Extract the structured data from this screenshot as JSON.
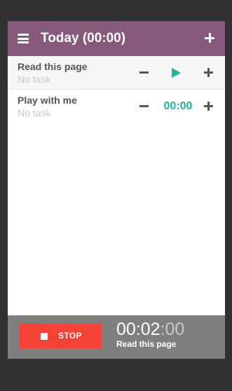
{
  "header": {
    "title": "Today (00:00)",
    "menu_icon": "hamburger-menu-icon",
    "add_icon": "plus-icon",
    "background_color": "#875a7b"
  },
  "activities": [
    {
      "name": "Read this page",
      "task": "No task",
      "state": "running",
      "control_icon": "play-icon"
    },
    {
      "name": "Play with me",
      "task": "No task",
      "state": "idle",
      "time": "00:00"
    }
  ],
  "footer": {
    "stop_label": "STOP",
    "stop_icon": "stop-square-icon",
    "timer_main": "00:02",
    "timer_seconds": ":00",
    "current_activity": "Read this page",
    "stop_color": "#f44336",
    "accent_color": "#1fb39a"
  }
}
